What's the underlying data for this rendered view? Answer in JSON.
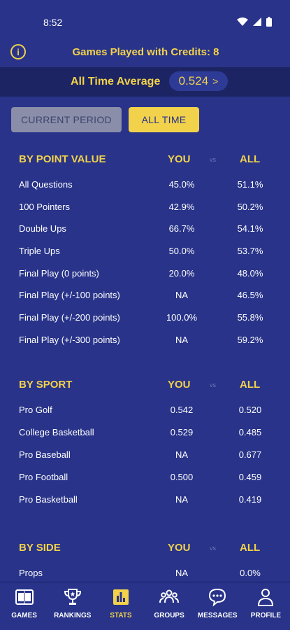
{
  "status_bar": {
    "time": "8:52",
    "icons": [
      "wifi-icon",
      "signal-icon",
      "battery-icon"
    ]
  },
  "header": {
    "info_icon": "i",
    "credits_text": "Games Played with Credits: 8",
    "average_label": "All Time Average",
    "average_value": "0.524",
    "average_chevron": ">"
  },
  "toggle": {
    "current_label": "CURRENT PERIOD",
    "alltime_label": "ALL TIME",
    "active": "ALL TIME"
  },
  "sections": [
    {
      "title": "BY POINT VALUE",
      "you": "YOU",
      "vs": "vs",
      "all": "ALL",
      "rows": [
        {
          "label": "All Questions",
          "you": "45.0%",
          "all": "51.1%"
        },
        {
          "label": "100 Pointers",
          "you": "42.9%",
          "all": "50.2%"
        },
        {
          "label": "Double Ups",
          "you": "66.7%",
          "all": "54.1%"
        },
        {
          "label": "Triple Ups",
          "you": "50.0%",
          "all": "53.7%"
        },
        {
          "label": "Final Play (0 points)",
          "you": "20.0%",
          "all": "48.0%"
        },
        {
          "label": "Final Play (+/-100 points)",
          "you": "NA",
          "all": "46.5%"
        },
        {
          "label": "Final Play (+/-200 points)",
          "you": "100.0%",
          "all": "55.8%"
        },
        {
          "label": "Final Play (+/-300 points)",
          "you": "NA",
          "all": "59.2%"
        }
      ]
    },
    {
      "title": "BY SPORT",
      "you": "YOU",
      "vs": "vs",
      "all": "ALL",
      "rows": [
        {
          "label": "Pro Golf",
          "you": "0.542",
          "all": "0.520"
        },
        {
          "label": "College Basketball",
          "you": "0.529",
          "all": "0.485"
        },
        {
          "label": "Pro Baseball",
          "you": "NA",
          "all": "0.677"
        },
        {
          "label": "Pro Football",
          "you": "0.500",
          "all": "0.459"
        },
        {
          "label": "Pro Basketball",
          "you": "NA",
          "all": "0.419"
        }
      ]
    },
    {
      "title": "BY SIDE",
      "you": "YOU",
      "vs": "vs",
      "all": "ALL",
      "rows": [
        {
          "label": "Props",
          "you": "NA",
          "all": "0.0%"
        }
      ]
    }
  ],
  "nav": [
    {
      "label": "GAMES",
      "icon": "games-icon"
    },
    {
      "label": "RANKINGS",
      "icon": "trophy-icon"
    },
    {
      "label": "STATS",
      "icon": "stats-icon"
    },
    {
      "label": "GROUPS",
      "icon": "groups-icon"
    },
    {
      "label": "MESSAGES",
      "icon": "messages-icon"
    },
    {
      "label": "PROFILE",
      "icon": "profile-icon"
    }
  ],
  "colors": {
    "background": "#283389",
    "accent": "#f2d24b",
    "bar": "#1c2463",
    "inactive_button": "#8a8ea8"
  }
}
